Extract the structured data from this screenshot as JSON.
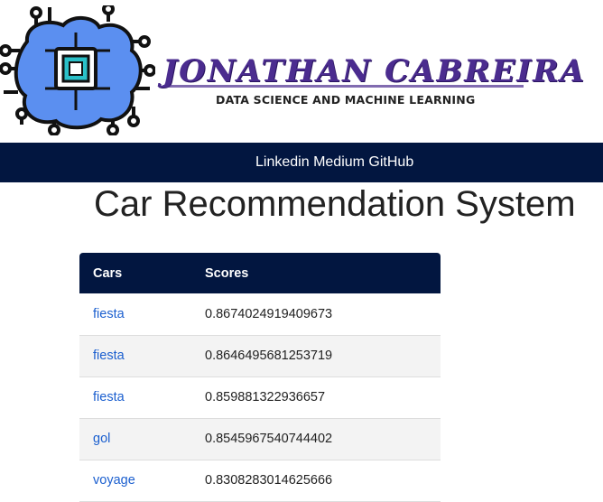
{
  "brand": {
    "name": "JONATHAN  CABREIRA",
    "tagline": "DATA SCIENCE AND MACHINE LEARNING",
    "colors": {
      "brand_purple": "#4b2c8f",
      "brain_blue": "#5b8ff0",
      "chip_teal": "#2bc0c8"
    }
  },
  "nav": {
    "links": [
      "Linkedin",
      "Medium",
      "GitHub"
    ],
    "background": "#021640"
  },
  "page": {
    "title": "Car Recommendation System"
  },
  "table": {
    "columns": [
      "Cars",
      "Scores"
    ],
    "rows": [
      {
        "car": "fiesta",
        "score": "0.8674024919409673"
      },
      {
        "car": "fiesta",
        "score": "0.8646495681253719"
      },
      {
        "car": "fiesta",
        "score": "0.859881322936657"
      },
      {
        "car": "gol",
        "score": "0.8545967540744402"
      },
      {
        "car": "voyage",
        "score": "0.8308283014625666"
      }
    ]
  }
}
